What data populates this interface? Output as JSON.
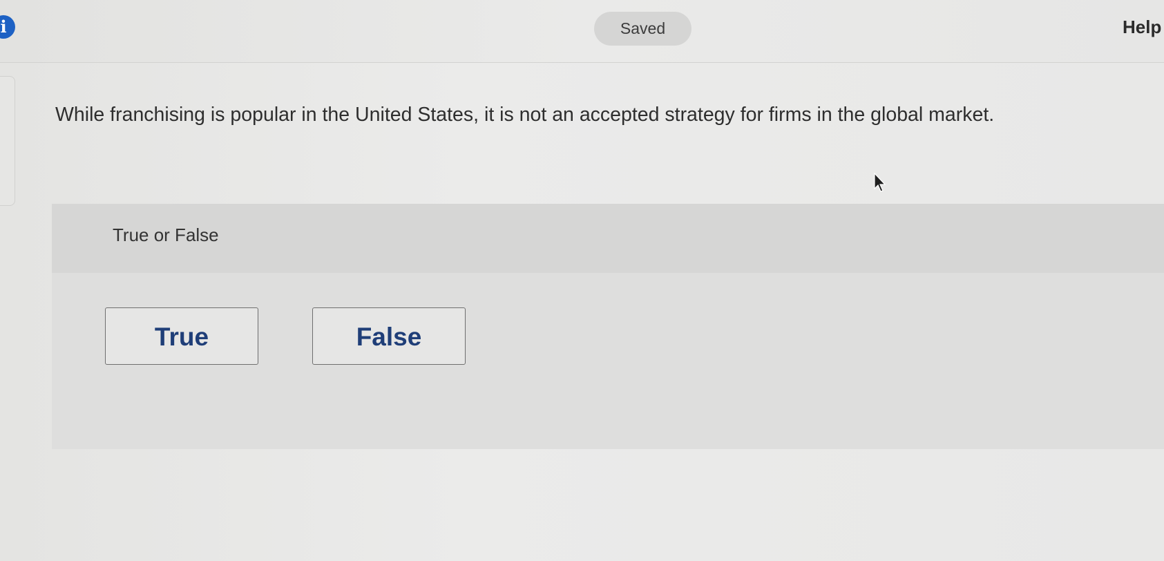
{
  "header": {
    "info_icon": "info-icon",
    "info_glyph": "i",
    "status_label": "Saved",
    "help_label": "Help"
  },
  "question": {
    "text": "While franchising is popular in the United States, it is not an accepted strategy for firms in the global market.",
    "prompt_label": "True or False",
    "choices": [
      "True",
      "False"
    ]
  },
  "colors": {
    "accent": "#1d61c4",
    "choice_text": "#1f3e78",
    "background": "#e9e9e8",
    "panel": "#dededd"
  },
  "icons": {
    "cursor": "mouse-pointer-icon"
  }
}
